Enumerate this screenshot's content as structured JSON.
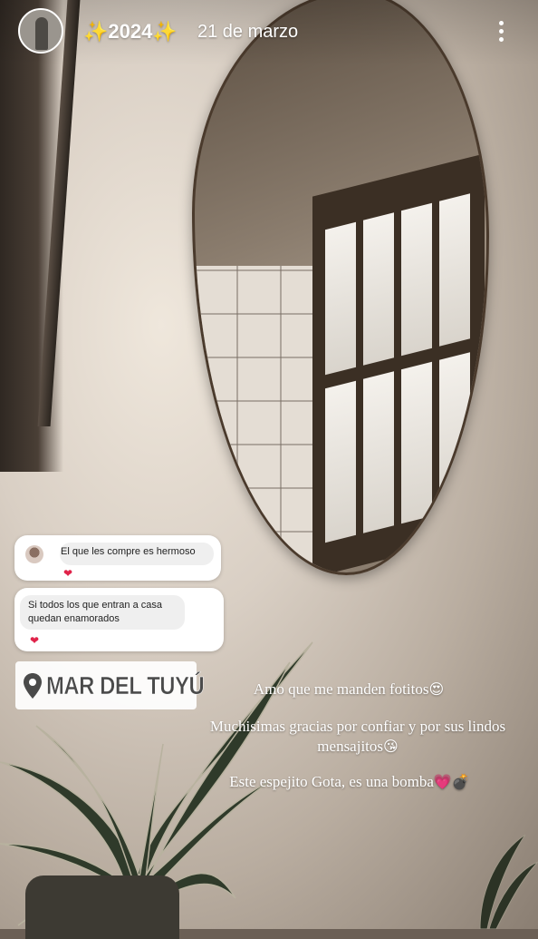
{
  "story": {
    "title": "✨2024✨",
    "date": "21 de marzo"
  },
  "messages": [
    {
      "text": "El que les compre es hermoso",
      "reaction": "❤"
    },
    {
      "text_line1": "Si todos los que entran  a casa",
      "text_line2": "quedan enamorados",
      "reaction": "❤"
    }
  ],
  "location": {
    "label": "MAR DEL TUYÚ"
  },
  "captions": {
    "line1": "Amo que me manden fotitos",
    "line1_emoji": "😍",
    "line2a": "Muchisimas gracias por confiar y por sus lindos",
    "line2b": "mensajitos",
    "line2_emoji": "😘",
    "line3": "Este espejito Gota, es una bomba",
    "line3_emoji": "💗💣"
  },
  "icons": {
    "avatar": "profile-avatar",
    "more": "more-vertical-icon",
    "pin": "location-pin-icon",
    "heart": "heart-icon"
  },
  "colors": {
    "heart": "#e0234a",
    "card": "#ffffff",
    "bubble": "#efefef"
  }
}
